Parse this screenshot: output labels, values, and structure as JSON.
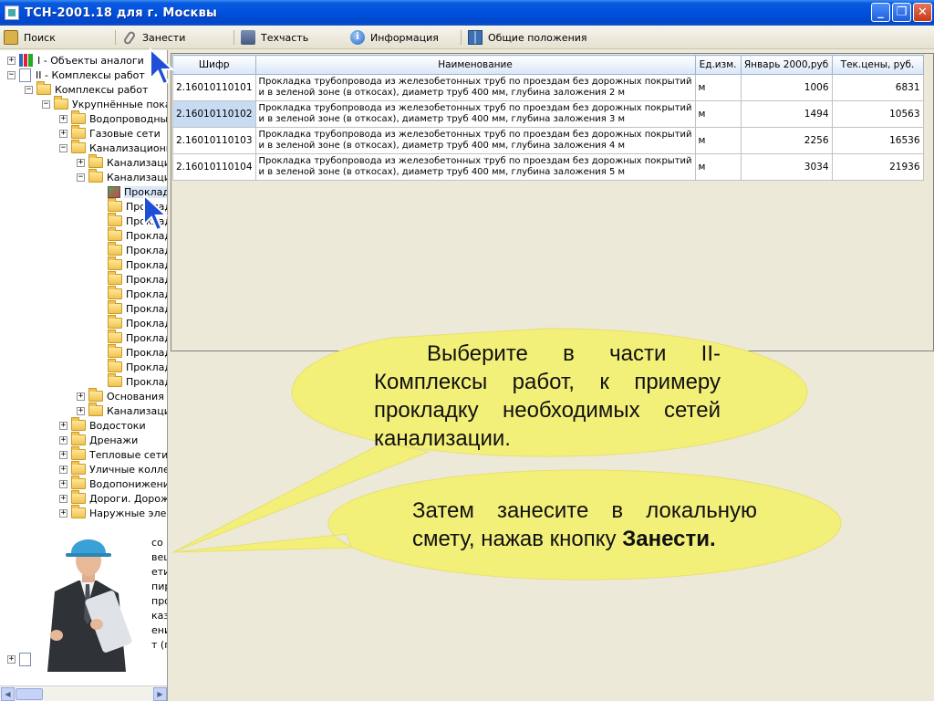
{
  "window": {
    "title": "ТСН-2001.18 для г. Москвы",
    "minimize": "_",
    "maximize": "❐",
    "close": "✕"
  },
  "toolbar": {
    "search": "Поиск",
    "add": "Занести",
    "techpart": "Техчасть",
    "info": "Информация",
    "general": "Общие положения"
  },
  "tree": {
    "items": [
      "I - Объекты аналоги",
      "II - Комплексы работ",
      "Комплексы работ",
      "Укрупнённые показ",
      "Водопроводные",
      "Газовые сети",
      "Канализационн",
      "Канализаци",
      "Канализаци",
      "Проклад",
      "Проклад",
      "Проклад",
      "Проклад",
      "Проклад",
      "Проклад",
      "Проклад",
      "Проклад",
      "Проклад",
      "Проклад",
      "Проклад",
      "Проклад",
      "Проклад",
      "Проклад",
      "Основания г",
      "Канализаци",
      "Водостоки",
      "Дренажи",
      "Тепловые сети",
      "Уличные коллек",
      "Водопонижение",
      "Дороги. Дорож",
      "Наружные элект"
    ],
    "partial": [
      "со",
      "вец",
      "ети",
      "пир",
      "про",
      "каз",
      "ени",
      "т (г"
    ]
  },
  "grid": {
    "headers": [
      "Шифр",
      "Наименование",
      "Ед.изм.",
      "Январь 2000,руб",
      "Тек.цены, руб."
    ],
    "rows": [
      {
        "code": "2.16010110101",
        "name": "Прокладка трубопровода из железобетонных труб по проездам без дорожных покрытий и в зеленой зоне (в откосах), диаметр труб 400 мм, глубина заложения 2 м",
        "unit": "м",
        "price2000": "1006",
        "current": "6831"
      },
      {
        "code": "2.16010110102",
        "name": "Прокладка трубопровода из железобетонных труб по проездам без дорожных покрытий и в зеленой зоне (в откосах), диаметр труб 400 мм, глубина заложения 3 м",
        "unit": "м",
        "price2000": "1494",
        "current": "10563"
      },
      {
        "code": "2.16010110103",
        "name": "Прокладка трубопровода из железобетонных труб по проездам без дорожных покрытий и в зеленой зоне (в откосах), диаметр труб 400 мм, глубина заложения 4 м",
        "unit": "м",
        "price2000": "2256",
        "current": "16536"
      },
      {
        "code": "2.16010110104",
        "name": "Прокладка трубопровода из железобетонных труб по проездам без дорожных покрытий и в зеленой зоне (в откосах), диаметр труб 400 мм, глубина заложения 5 м",
        "unit": "м",
        "price2000": "3034",
        "current": "21936"
      }
    ]
  },
  "callouts": {
    "first": "Выберите в части II-Комплексы работ, к примеру прокладку необходимых сетей канализации.",
    "second_prefix": "Затем занесите в локальную смету, нажав кнопку ",
    "second_bold": "Занести."
  },
  "colors": {
    "callout_fill": "#f3f07a",
    "titlebar": "#0050dd",
    "selection": "#c7dbf3"
  }
}
